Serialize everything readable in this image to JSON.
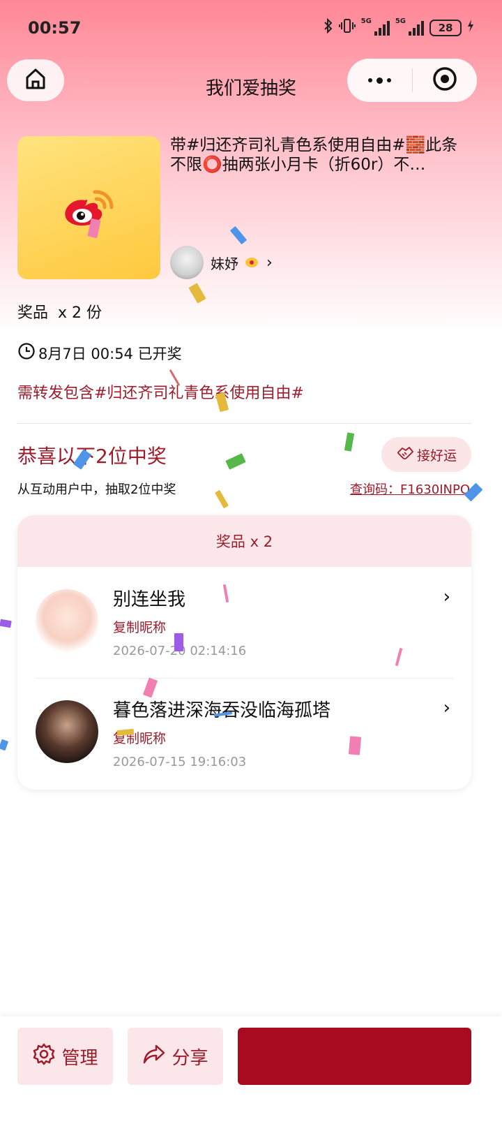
{
  "status_bar": {
    "time": "00:57",
    "network_labels": [
      "5G",
      "5G"
    ],
    "battery": "28",
    "icons": [
      "bluetooth-icon",
      "vibrate-icon",
      "signal-icon",
      "signal-icon",
      "battery-icon",
      "charging-icon"
    ]
  },
  "nav": {
    "title": "我们爱抽奖",
    "icons": [
      "home-icon",
      "more-icon",
      "target-icon"
    ]
  },
  "prize": {
    "title": "带#归还齐司礼青色系使用自由#🧱此条不限⭕抽两张小月卡（折60r）不…",
    "sponsor_name": "妹妤",
    "count_label": "奖品",
    "count_value": "x 2 份",
    "image_icon": "weibo-logo"
  },
  "draw": {
    "time_text": "8月7日 00:54 已开奖",
    "condition": "需转发包含#归还齐司礼青色系使用自由#",
    "winners_heading": "恭喜以下2位中奖",
    "good_luck_label": "接好运",
    "description": "从互动用户中，抽取2位中奖",
    "query_code": "查询码：F1630INPO"
  },
  "winners_card": {
    "header": "奖品 x 2",
    "winners": [
      {
        "name": "别连坐我",
        "copy_label": "复制昵称",
        "time": "2026-07-20 02:14:16"
      },
      {
        "name": "暮色落进深海吞没临海孤塔",
        "copy_label": "复制昵称",
        "time": "2026-07-15 19:16:03"
      }
    ]
  },
  "bottom_bar": {
    "manage_label": "管理",
    "share_label": "分享",
    "primary_label": ""
  },
  "colors": {
    "accent": "#9e1b2a",
    "primary_button": "#a80a1f",
    "header_gradient_top": "#ff8796",
    "soft_pink": "#fbe7e9"
  }
}
